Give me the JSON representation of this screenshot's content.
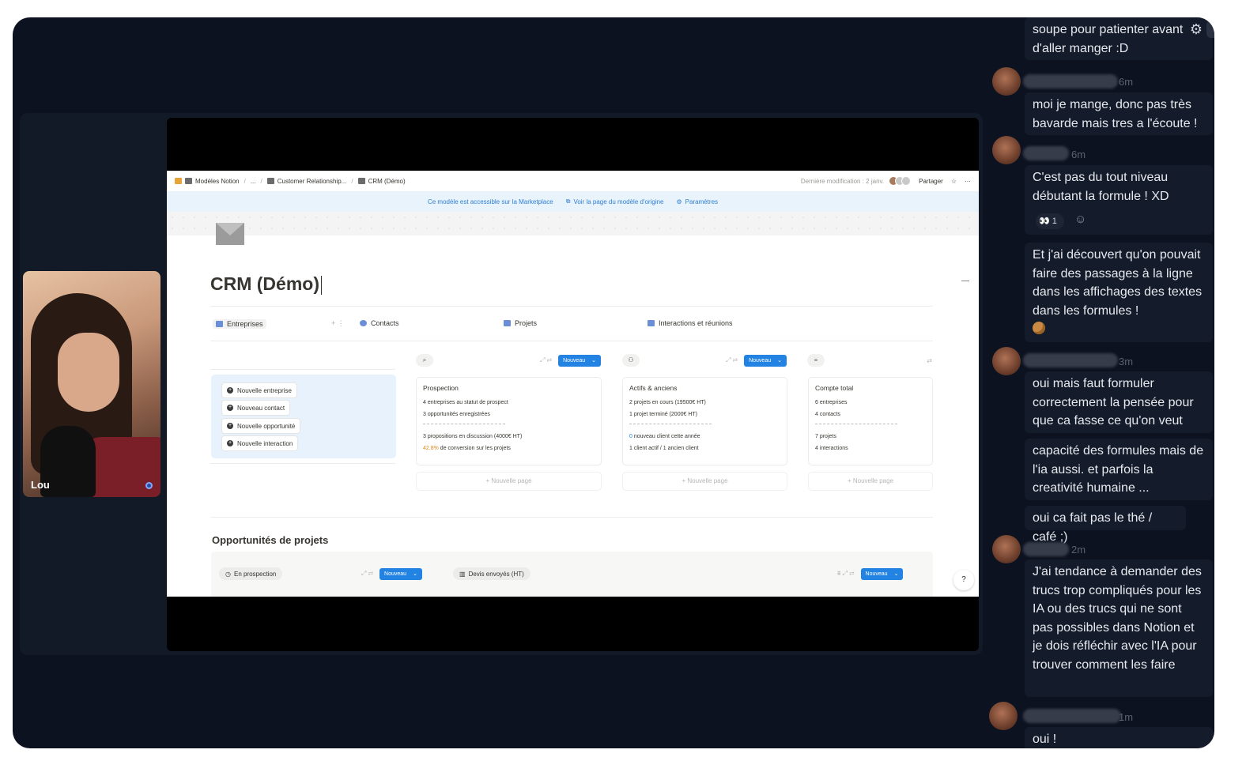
{
  "participant": {
    "name": "Lou"
  },
  "notion": {
    "breadcrumbs": [
      "Modèles Notion",
      "...",
      "Customer Relationship...",
      "CRM (Démo)"
    ],
    "last_modified": "Dernière modification : 2 janv.",
    "share_label": "Partager",
    "more_label": "···",
    "banner": {
      "marketplace": "Ce modèle est accessible sur la Marketplace",
      "view_original": "Voir la page du modèle d'origine",
      "settings": "Paramètres"
    },
    "title": "CRM (Démo)",
    "tabs": [
      "Entreprises",
      "Contacts",
      "Projets",
      "Interactions et réunions"
    ],
    "actions": [
      "Nouvelle entreprise",
      "Nouveau contact",
      "Nouvelle opportunité",
      "Nouvelle interaction"
    ],
    "new_button": "Nouveau",
    "new_page": "+ Nouvelle page",
    "cards": [
      {
        "title": "Prospection",
        "lines": [
          "4 entreprises au statut de prospect",
          "3 opportunités enregistrées"
        ],
        "lines2": [
          "3 propositions en discussion (4000€ HT)"
        ],
        "accent_value": "42.8%",
        "accent_text": " de conversion sur les projets"
      },
      {
        "title": "Actifs & anciens",
        "lines": [
          "2 projets en cours (19500€ HT)",
          "1 projet terminé (2000€ HT)"
        ],
        "accent_value": "0",
        "accent_text": " nouveau client cette année",
        "last_line": "1 client actif / 1 ancien client"
      },
      {
        "title": "Compte total",
        "lines": [
          "6 entreprises",
          "4 contacts"
        ],
        "lines2": [
          "7 projets",
          "4 interactions"
        ]
      }
    ],
    "opportunities_title": "Opportunités de projets",
    "board_chips": [
      "En prospection",
      "Devis envoyés (HT)"
    ],
    "help_label": "?"
  },
  "chat": {
    "messages": [
      {
        "text": "soupe pour patienter avant d'aller manger :D"
      },
      {
        "time": "6m",
        "text": "moi je mange, donc pas très bavarde mais tres a l'écoute !"
      },
      {
        "time": "6m",
        "text": "C'est pas du tout niveau débutant la formule ! XD",
        "reaction": "👀",
        "reaction_count": "1"
      },
      {
        "text": "Et j'ai découvert qu'on pouvait faire des passages à la ligne dans les affichages des textes dans les formules !"
      },
      {
        "time": "3m",
        "text": "oui mais faut formuler correctement la pensée pour que ca fasse ce qu'on veut"
      },
      {
        "text": "capacité des formules mais de l'ia aussi. et parfois la creativité humaine ..."
      },
      {
        "text": "oui ca fait pas le thé / café ;)"
      },
      {
        "time": "2m",
        "text": "J'ai tendance à demander des trucs trop compliqués pour les IA ou des trucs qui ne sont pas possibles dans Notion et je dois réfléchir avec l'IA pour trouver comment les faire"
      },
      {
        "time": "1m",
        "text": "oui !"
      }
    ]
  },
  "colors": {
    "accent_blue": "#2383e2",
    "chat_bg": "#0c1220",
    "bubble": "#141c2b"
  }
}
